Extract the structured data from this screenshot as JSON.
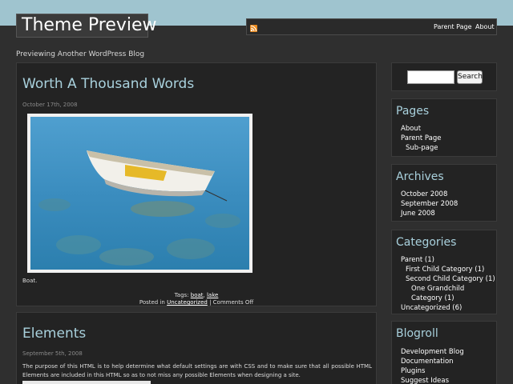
{
  "site": {
    "title": "Theme Preview",
    "tagline": "Previewing Another WordPress Blog"
  },
  "nav": {
    "rss_icon": "rss-icon",
    "items": [
      {
        "label": "Parent Page"
      },
      {
        "label": "About"
      }
    ]
  },
  "posts": [
    {
      "title": "Worth A Thousand Words",
      "date": "October 17th, 2008",
      "caption": "Boat.",
      "tags_label": "Tags:",
      "tags": [
        "boat",
        "lake"
      ],
      "posted_in_label": "Posted in",
      "category": "Uncategorized",
      "comments": "| Comments Off"
    },
    {
      "title": "Elements",
      "date": "September 5th, 2008",
      "excerpt": "The purpose of this HTML is to help determine what default settings are with CSS and to make sure that all possible HTML Elements are included in this HTML so as to not miss any possible Elements when designing a site."
    }
  ],
  "sidebar": {
    "search": {
      "value": "",
      "button_label": "Search"
    },
    "pages": {
      "title": "Pages",
      "items": [
        "About",
        "Parent Page",
        "Sub-page"
      ]
    },
    "archives": {
      "title": "Archives",
      "items": [
        "October 2008",
        "September 2008",
        "June 2008"
      ]
    },
    "categories": {
      "title": "Categories",
      "items": [
        "Parent (1)",
        "First Child Category (1)",
        "Second Child Category (1)",
        "One Grandchild Category (1)",
        "Uncategorized (6)"
      ]
    },
    "blogroll": {
      "title": "Blogroll",
      "items": [
        "Development Blog",
        "Documentation",
        "Plugins",
        "Suggest Ideas"
      ]
    }
  },
  "colors": {
    "background": "#2f2f2f",
    "header_band": "#9fc4cf",
    "heading_accent": "#a9d1dd",
    "panel": "#232323",
    "rss": "#e98a1f"
  }
}
